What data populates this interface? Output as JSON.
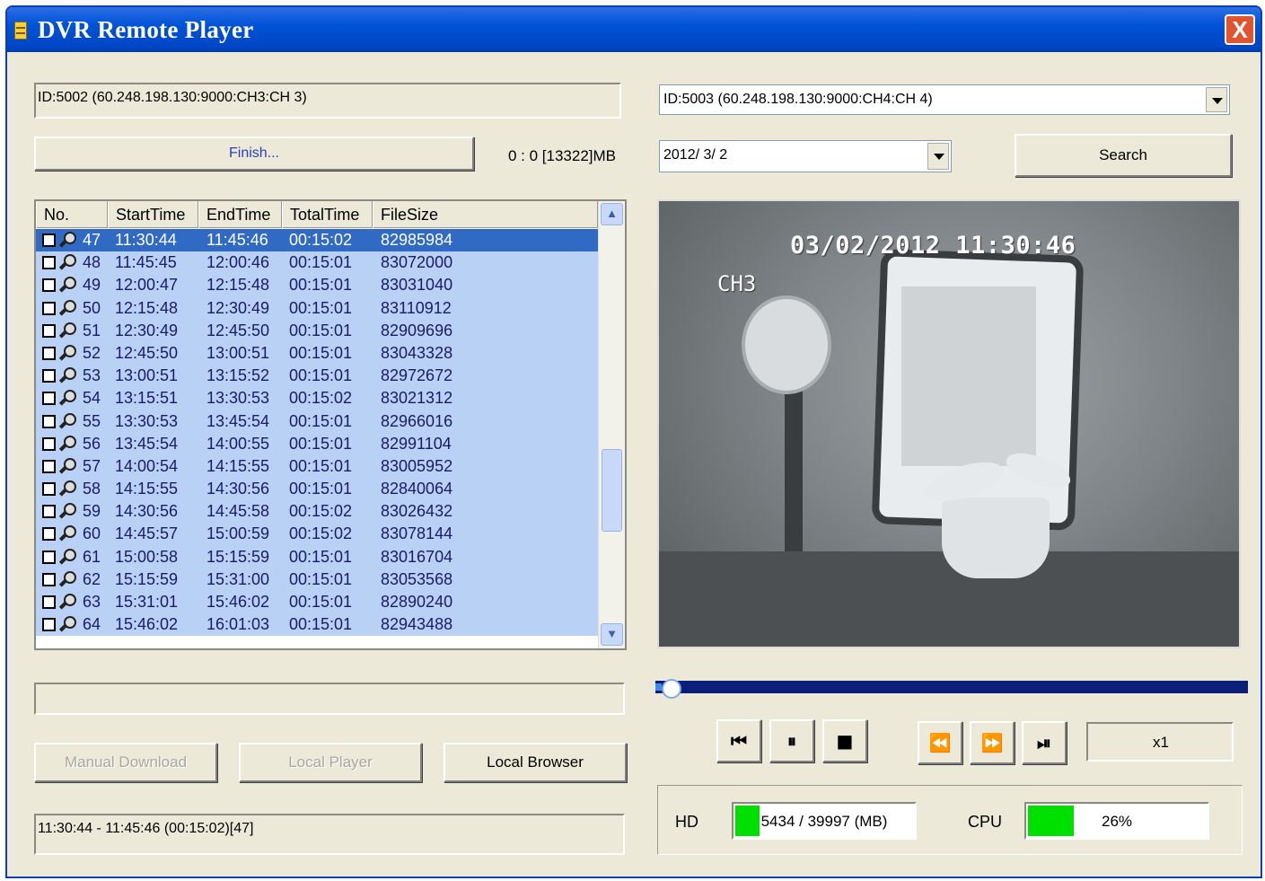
{
  "window": {
    "title": "DVR Remote Player",
    "close_label": "X"
  },
  "left": {
    "channel_id": "ID:5002 (60.248.198.130:9000:CH3:CH 3)",
    "finish_label": "Finish...",
    "storage_info": "0 : 0 [13322]MB",
    "progress_text": "",
    "selection_info": "11:30:44 - 11:45:46 (00:15:02)[47]",
    "buttons": {
      "manual_download": "Manual Download",
      "local_player": "Local Player",
      "local_browser": "Local Browser"
    }
  },
  "table": {
    "columns": [
      "No.",
      "StartTime",
      "EndTime",
      "TotalTime",
      "FileSize"
    ],
    "rows": [
      {
        "no": "47",
        "start": "11:30:44",
        "end": "11:45:46",
        "total": "00:15:02",
        "size": "82985984",
        "selected": true
      },
      {
        "no": "48",
        "start": "11:45:45",
        "end": "12:00:46",
        "total": "00:15:01",
        "size": "83072000"
      },
      {
        "no": "49",
        "start": "12:00:47",
        "end": "12:15:48",
        "total": "00:15:01",
        "size": "83031040"
      },
      {
        "no": "50",
        "start": "12:15:48",
        "end": "12:30:49",
        "total": "00:15:01",
        "size": "83110912"
      },
      {
        "no": "51",
        "start": "12:30:49",
        "end": "12:45:50",
        "total": "00:15:01",
        "size": "82909696"
      },
      {
        "no": "52",
        "start": "12:45:50",
        "end": "13:00:51",
        "total": "00:15:01",
        "size": "83043328"
      },
      {
        "no": "53",
        "start": "13:00:51",
        "end": "13:15:52",
        "total": "00:15:01",
        "size": "82972672"
      },
      {
        "no": "54",
        "start": "13:15:51",
        "end": "13:30:53",
        "total": "00:15:02",
        "size": "83021312"
      },
      {
        "no": "55",
        "start": "13:30:53",
        "end": "13:45:54",
        "total": "00:15:01",
        "size": "82966016"
      },
      {
        "no": "56",
        "start": "13:45:54",
        "end": "14:00:55",
        "total": "00:15:01",
        "size": "82991104"
      },
      {
        "no": "57",
        "start": "14:00:54",
        "end": "14:15:55",
        "total": "00:15:01",
        "size": "83005952"
      },
      {
        "no": "58",
        "start": "14:15:55",
        "end": "14:30:56",
        "total": "00:15:01",
        "size": "82840064"
      },
      {
        "no": "59",
        "start": "14:30:56",
        "end": "14:45:58",
        "total": "00:15:02",
        "size": "83026432"
      },
      {
        "no": "60",
        "start": "14:45:57",
        "end": "15:00:59",
        "total": "00:15:02",
        "size": "83078144"
      },
      {
        "no": "61",
        "start": "15:00:58",
        "end": "15:15:59",
        "total": "00:15:01",
        "size": "83016704"
      },
      {
        "no": "62",
        "start": "15:15:59",
        "end": "15:31:00",
        "total": "00:15:01",
        "size": "83053568"
      },
      {
        "no": "63",
        "start": "15:31:01",
        "end": "15:46:02",
        "total": "00:15:01",
        "size": "82890240"
      },
      {
        "no": "64",
        "start": "15:46:02",
        "end": "16:01:03",
        "total": "00:15:01",
        "size": "82943488"
      }
    ]
  },
  "right": {
    "channel_select": "ID:5003 (60.248.198.130:9000:CH4:CH 4)",
    "date_select": "2012/  3/  2",
    "search_label": "Search",
    "video": {
      "timestamp": "03/02/2012 11:30:46",
      "channel": "CH3"
    },
    "seek_progress": 0.01,
    "speed": "x1",
    "playback_buttons": [
      {
        "name": "skip-to-start-icon",
        "glyph": "⏮"
      },
      {
        "name": "pause-icon",
        "glyph": "⏸"
      },
      {
        "name": "stop-icon",
        "glyph": "■"
      },
      {
        "name": "rewind-icon",
        "glyph": "⏪"
      },
      {
        "name": "fast-forward-icon",
        "glyph": "⏩"
      },
      {
        "name": "step-forward-icon",
        "glyph": "⏯"
      }
    ],
    "status": {
      "hd_label": "HD",
      "hd_text": "5434 / 39997 (MB)",
      "hd_fraction": 0.136,
      "cpu_label": "CPU",
      "cpu_text": "26%",
      "cpu_fraction": 0.26
    }
  },
  "colors": {
    "title_bar": "#0052d6",
    "selection": "#316ac5",
    "row_bg": "#b9d1f4",
    "gauge_fill": "#00e000"
  }
}
